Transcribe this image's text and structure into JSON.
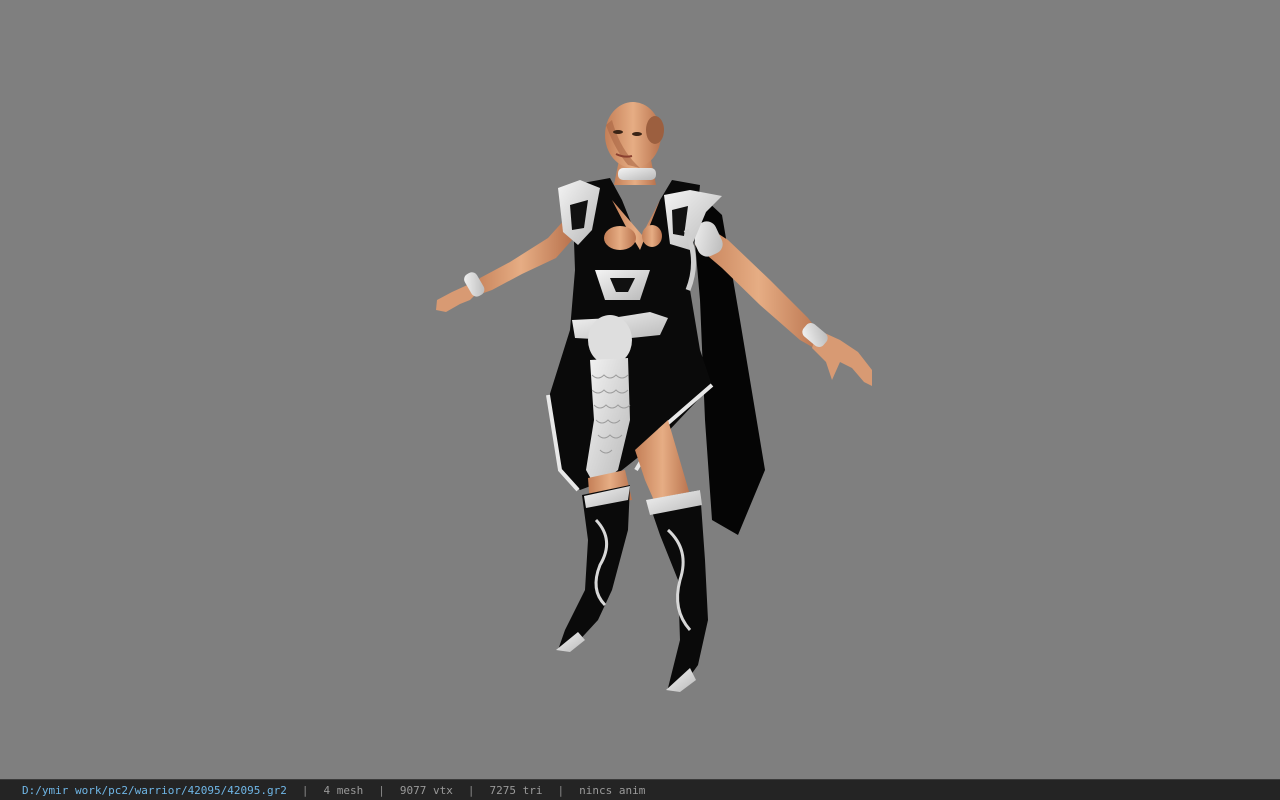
{
  "viewer": {
    "background_color": "#7f7f7f",
    "model_name": "42095.gr2"
  },
  "statusbar": {
    "file_path": "D:/ymir work/pc2/warrior/42095/42095.gr2",
    "separator": "|",
    "mesh_count": "4 mesh",
    "vertex_count": "9077 vtx",
    "triangle_count": "7275 tri",
    "anim_info": "nincs anim",
    "path_color": "#6fb6e6",
    "bar_color": "#242424"
  }
}
